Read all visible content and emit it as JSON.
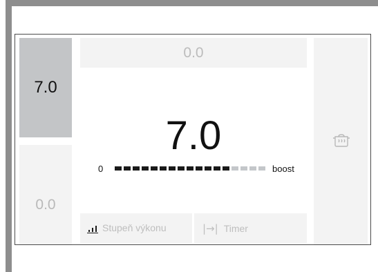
{
  "zones": {
    "left_top": {
      "value": "7.0"
    },
    "left_bottom": {
      "value": "0.0"
    },
    "top_center": {
      "value": "0.0"
    }
  },
  "main": {
    "value": "7.0",
    "scale_min_label": "0",
    "scale_max_label": "boost",
    "level_segments_total": 17,
    "level_segments_on": 13
  },
  "buttons": {
    "power_label": "Stupeň výkonu",
    "timer_label": "Timer"
  },
  "icons": {
    "power": "power-level-bars-icon",
    "timer": "timer-arrow-icon",
    "pot": "cookware-pot-icon"
  },
  "colors": {
    "active_zone": "#c3c5c7",
    "idle_zone": "#f3f3f3",
    "bezel": "#8e8e8e"
  }
}
